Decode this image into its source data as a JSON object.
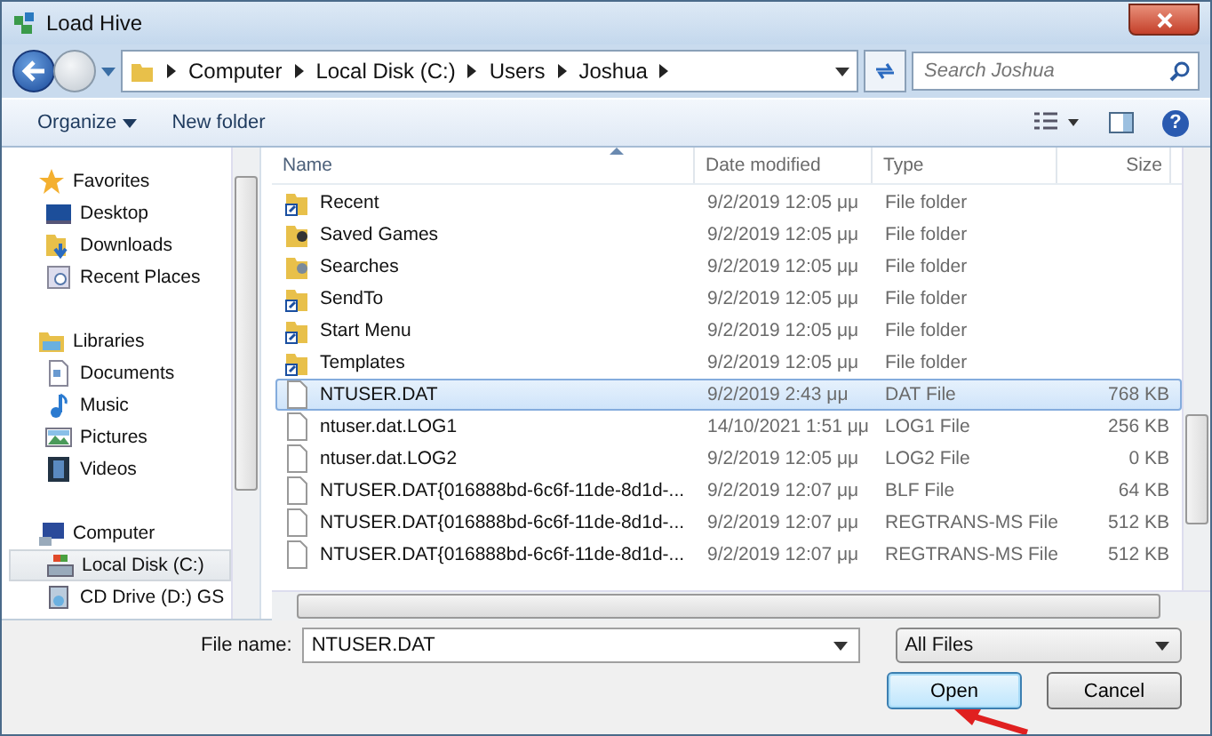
{
  "window": {
    "title": "Load Hive"
  },
  "address": {
    "breadcrumb": [
      "Computer",
      "Local Disk (C:)",
      "Users",
      "Joshua"
    ]
  },
  "search": {
    "placeholder": "Search Joshua"
  },
  "toolbar": {
    "organize": "Organize",
    "new_folder": "New folder",
    "help": "?"
  },
  "sidebar": {
    "groups": [
      {
        "label": "Favorites",
        "kind": "star",
        "children": [
          {
            "label": "Desktop",
            "kind": "desktop",
            "selected": false
          },
          {
            "label": "Downloads",
            "kind": "downloads",
            "selected": false
          },
          {
            "label": "Recent Places",
            "kind": "recent",
            "selected": false
          }
        ]
      },
      {
        "label": "Libraries",
        "kind": "library",
        "children": [
          {
            "label": "Documents",
            "kind": "documents",
            "selected": false
          },
          {
            "label": "Music",
            "kind": "music",
            "selected": false
          },
          {
            "label": "Pictures",
            "kind": "pictures",
            "selected": false
          },
          {
            "label": "Videos",
            "kind": "videos",
            "selected": false
          }
        ]
      },
      {
        "label": "Computer",
        "kind": "computer",
        "children": [
          {
            "label": "Local Disk (C:)",
            "kind": "disk",
            "selected": true
          },
          {
            "label": "CD Drive (D:) GS",
            "kind": "cd",
            "selected": false
          }
        ]
      }
    ]
  },
  "table": {
    "columns": [
      {
        "label": "Name",
        "sorted": true
      },
      {
        "label": "Date modified",
        "sorted": false
      },
      {
        "label": "Type",
        "sorted": false
      },
      {
        "label": "Size",
        "sorted": false
      }
    ],
    "rows": [
      {
        "kind": "shortcut",
        "name": "Recent",
        "date": "9/2/2019 12:05 μμ",
        "type": "File folder",
        "size": "",
        "selected": false
      },
      {
        "kind": "games",
        "name": "Saved Games",
        "date": "9/2/2019 12:05 μμ",
        "type": "File folder",
        "size": "",
        "selected": false
      },
      {
        "kind": "search",
        "name": "Searches",
        "date": "9/2/2019 12:05 μμ",
        "type": "File folder",
        "size": "",
        "selected": false
      },
      {
        "kind": "shortcut",
        "name": "SendTo",
        "date": "9/2/2019 12:05 μμ",
        "type": "File folder",
        "size": "",
        "selected": false
      },
      {
        "kind": "shortcut",
        "name": "Start Menu",
        "date": "9/2/2019 12:05 μμ",
        "type": "File folder",
        "size": "",
        "selected": false
      },
      {
        "kind": "shortcut",
        "name": "Templates",
        "date": "9/2/2019 12:05 μμ",
        "type": "File folder",
        "size": "",
        "selected": false
      },
      {
        "kind": "file",
        "name": "NTUSER.DAT",
        "date": "9/2/2019 2:43 μμ",
        "type": "DAT File",
        "size": "768 KB",
        "selected": true
      },
      {
        "kind": "file",
        "name": "ntuser.dat.LOG1",
        "date": "14/10/2021 1:51 μμ",
        "type": "LOG1 File",
        "size": "256 KB",
        "selected": false
      },
      {
        "kind": "file",
        "name": "ntuser.dat.LOG2",
        "date": "9/2/2019 12:05 μμ",
        "type": "LOG2 File",
        "size": "0 KB",
        "selected": false
      },
      {
        "kind": "file",
        "name": "NTUSER.DAT{016888bd-6c6f-11de-8d1d-...",
        "date": "9/2/2019 12:07 μμ",
        "type": "BLF File",
        "size": "64 KB",
        "selected": false
      },
      {
        "kind": "file",
        "name": "NTUSER.DAT{016888bd-6c6f-11de-8d1d-...",
        "date": "9/2/2019 12:07 μμ",
        "type": "REGTRANS-MS File",
        "size": "512 KB",
        "selected": false
      },
      {
        "kind": "file",
        "name": "NTUSER.DAT{016888bd-6c6f-11de-8d1d-...",
        "date": "9/2/2019 12:07 μμ",
        "type": "REGTRANS-MS File",
        "size": "512 KB",
        "selected": false
      }
    ]
  },
  "file_name": {
    "label": "File name:",
    "value": "NTUSER.DAT"
  },
  "file_type": {
    "value": "All Files"
  },
  "buttons": [
    {
      "label": "Open",
      "default": true
    },
    {
      "label": "Cancel",
      "default": false
    }
  ]
}
